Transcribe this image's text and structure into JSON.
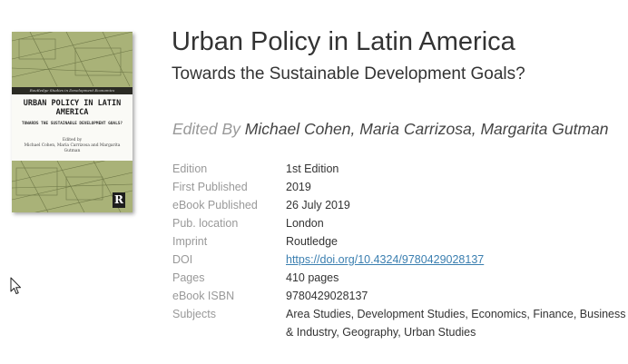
{
  "book": {
    "title": "Urban Policy in Latin America",
    "subtitle": "Towards the Sustainable Development Goals?",
    "edited_by_label": "Edited By",
    "editors": "Michael Cohen, Maria Carrizosa, Margarita Gutman"
  },
  "cover": {
    "series": "Routledge Studies in Development Economics",
    "title": "URBAN POLICY IN LATIN AMERICA",
    "subtitle": "TOWARDS THE SUSTAINABLE DEVELOPMENT GOALS?",
    "edited_label": "Edited by",
    "editors": "Michael Cohen, Maria Carrizosa and Margarita Gutman",
    "publisher_logo": "R",
    "colors": {
      "background": "#a9b278",
      "band": "#2b2b24",
      "panel": "#fafaf6"
    }
  },
  "details": [
    {
      "key": "Edition",
      "value": "1st Edition"
    },
    {
      "key": "First Published",
      "value": "2019"
    },
    {
      "key": "eBook Published",
      "value": "26 July 2019"
    },
    {
      "key": "Pub. location",
      "value": "London"
    },
    {
      "key": "Imprint",
      "value": "Routledge"
    },
    {
      "key": "DOI",
      "value": "https://doi.org/10.4324/9780429028137",
      "link": true
    },
    {
      "key": "Pages",
      "value": "410 pages"
    },
    {
      "key": "eBook ISBN",
      "value": "9780429028137"
    },
    {
      "key": "Subjects",
      "value": "Area Studies, Development Studies, Economics, Finance, Business & Industry, Geography, Urban Studies"
    }
  ],
  "icons": {
    "cursor": "mouse-pointer-icon"
  },
  "colors": {
    "link": "#3b7fb0",
    "label": "#999999",
    "text": "#333333"
  }
}
